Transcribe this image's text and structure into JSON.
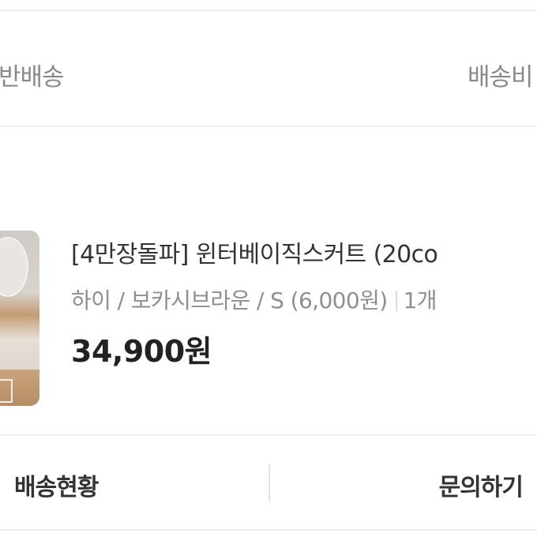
{
  "shipping": {
    "type_label": "반배송",
    "fee_label": "배송비"
  },
  "product": {
    "name": "[4만장돌파] 윈터베이직스커트 (20co",
    "options": "하이 / 보카시브라운 / S  (6,000원)",
    "quantity": "1개",
    "price": "34,900원",
    "thumbnail_icon": "product-photo"
  },
  "actions": {
    "track_label": "배송현황",
    "inquiry_label": "문의하기"
  },
  "colors": {
    "text_primary": "#222222",
    "text_secondary": "#8a8a8a",
    "divider": "#f0f0f0"
  }
}
